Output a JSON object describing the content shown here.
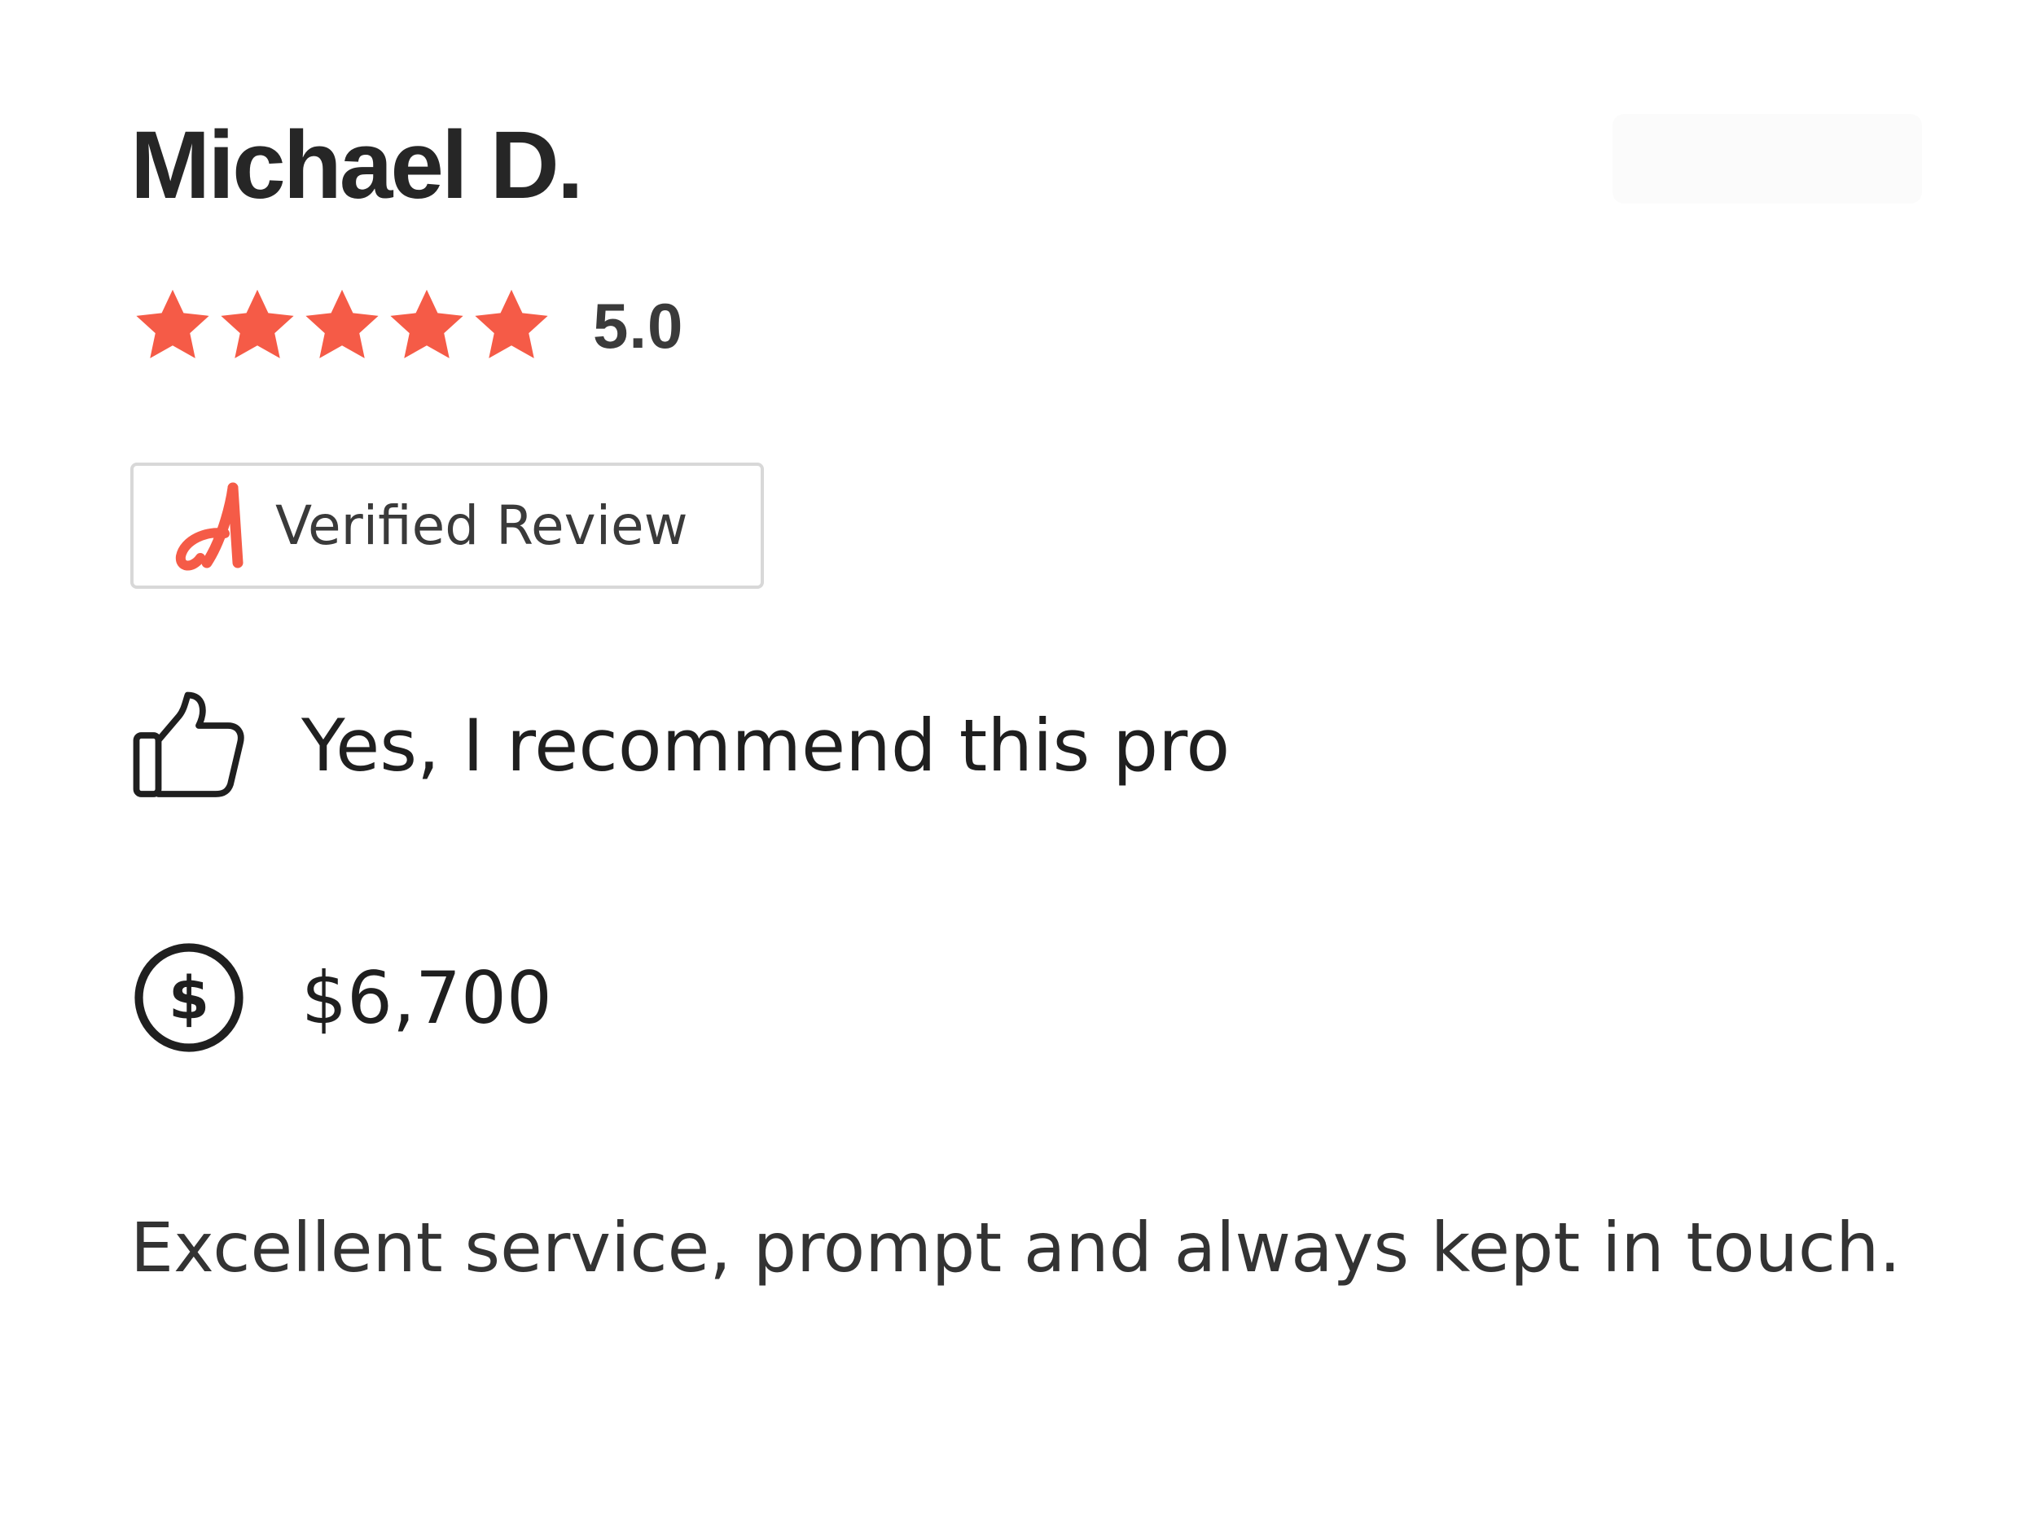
{
  "review": {
    "reviewer_name": "Michael D.",
    "rating": {
      "value": 5.0,
      "max": 5,
      "display": "5.0",
      "star_color": "#F55B47"
    },
    "verified_badge": {
      "label": "Verified Review",
      "logo_icon": "angi-logo-icon",
      "logo_color": "#F55B47"
    },
    "recommendation": {
      "icon": "thumbs-up-icon",
      "text": "Yes, I recommend this pro"
    },
    "cost": {
      "icon": "dollar-circle-icon",
      "text": "$6,700"
    },
    "body": "Excellent service, prompt and always kept in touch."
  }
}
